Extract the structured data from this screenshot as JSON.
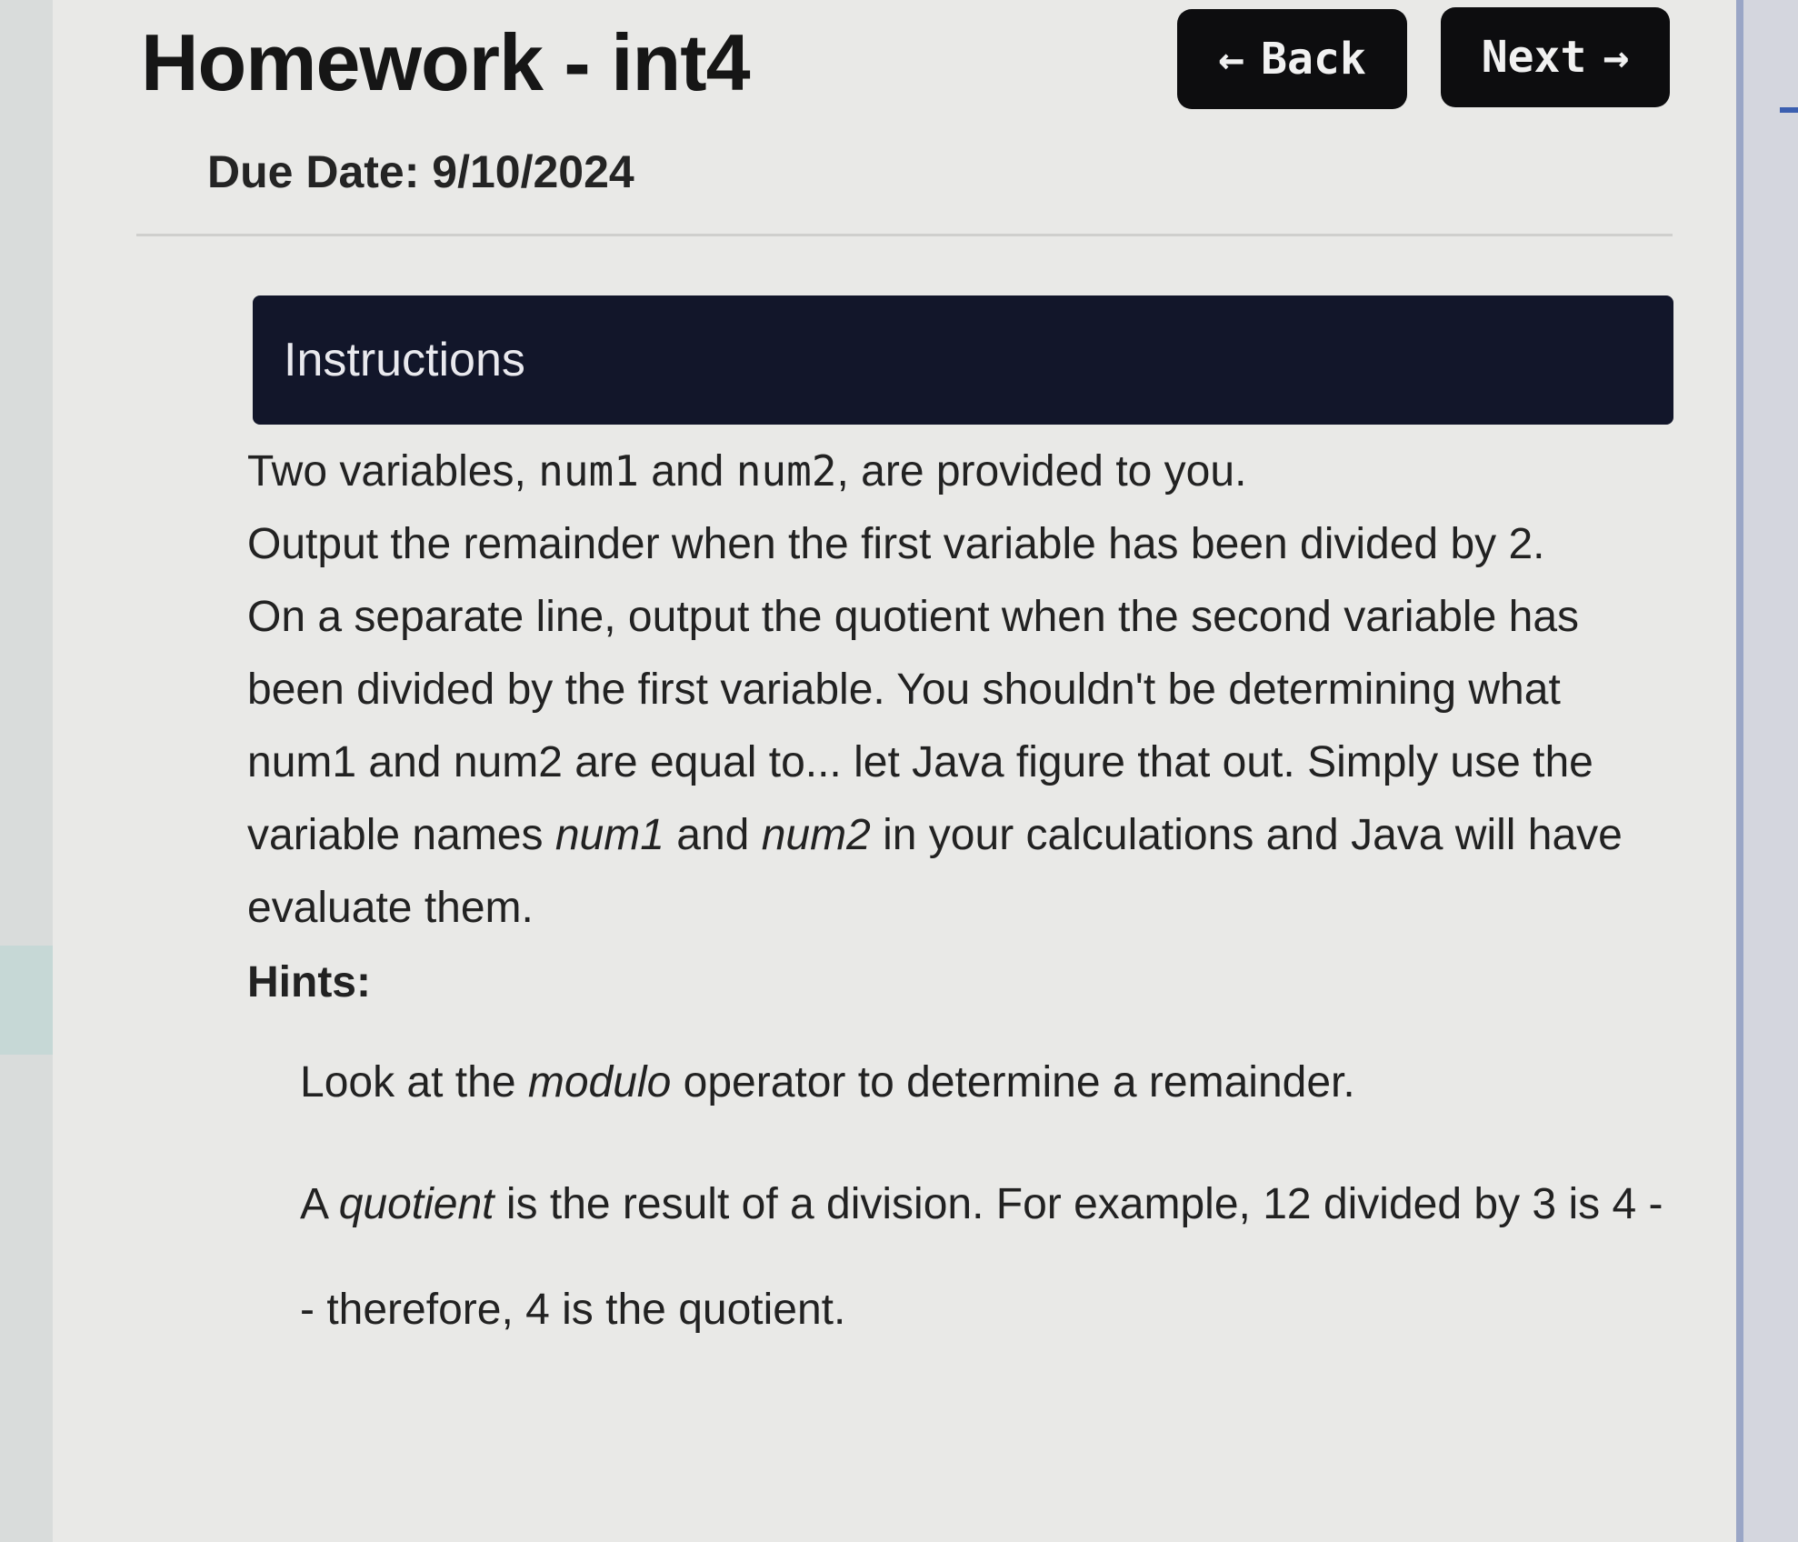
{
  "header": {
    "title": "Homework - int4",
    "due_label": "Due Date: 9/10/2024",
    "back_label": "Back",
    "next_label": "Next"
  },
  "instructions": {
    "heading": "Instructions",
    "p1_a": "Two variables, ",
    "p1_code1": "num1",
    "p1_b": " and ",
    "p1_code2": "num2",
    "p1_c": ", are provided to you.",
    "p2": "Output the remainder when the first variable has been divided by 2.",
    "p3_a": "On a separate line, output the quotient when the second variable has been divided by the first variable. You shouldn't be determining what num1 and num2 are equal to... let Java figure that out. Simply use the variable names ",
    "p3_em1": "num1",
    "p3_b": " and ",
    "p3_em2": "num2",
    "p3_c": " in your calculations and Java will have evaluate them.",
    "hints_label": "Hints:",
    "hint1_a": "Look at the ",
    "hint1_em": "modulo",
    "hint1_b": " operator to determine a remainder.",
    "hint2_a": "A ",
    "hint2_em": "quotient",
    "hint2_b": " is the result of a division. For example, 12 divided by 3 is 4 -- therefore, 4 is the quotient."
  },
  "icons": {
    "back": "arrow-left-icon",
    "next": "arrow-right-icon"
  },
  "colors": {
    "button_bg": "#0d0d0f",
    "header_bg": "#12162a",
    "page_bg": "#e9e9e7"
  }
}
